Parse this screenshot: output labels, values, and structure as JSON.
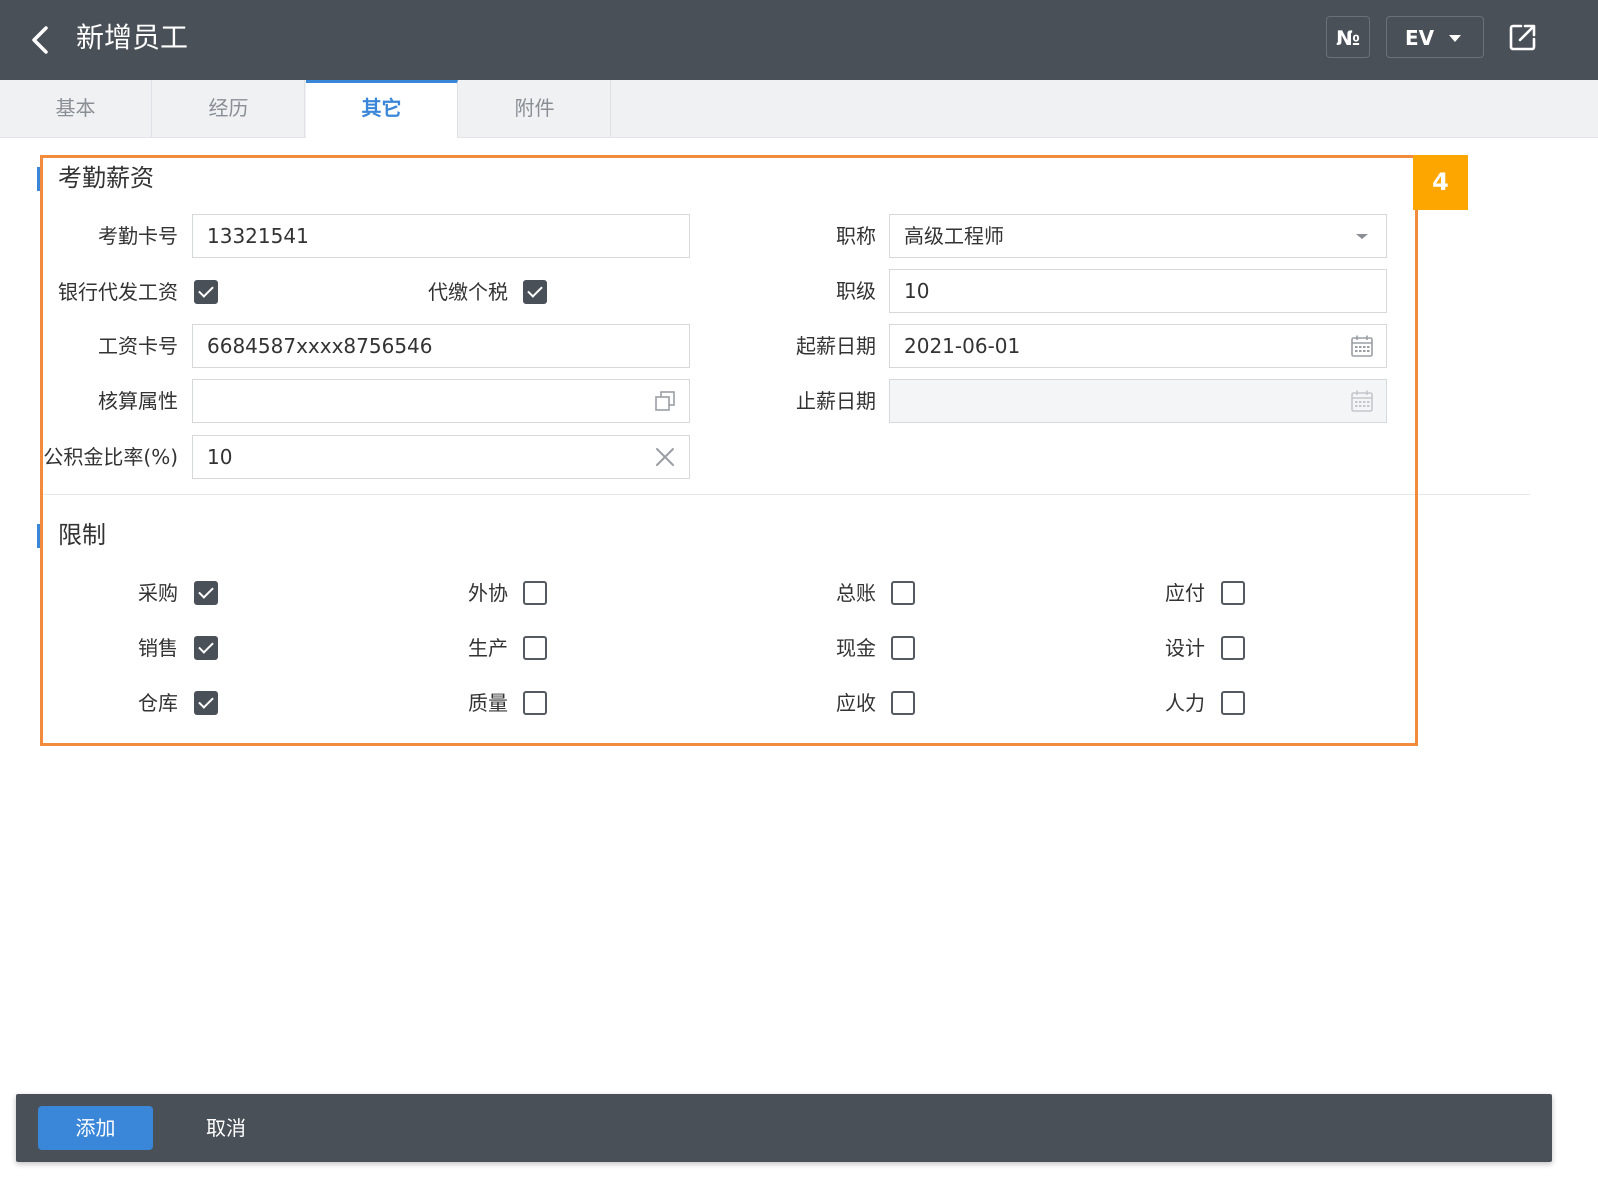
{
  "header": {
    "title": "新增员工",
    "no_label": "№",
    "ev_label": "EV"
  },
  "tabs": [
    {
      "label": "基本",
      "active": false
    },
    {
      "label": "经历",
      "active": false
    },
    {
      "label": "其它",
      "active": true
    },
    {
      "label": "附件",
      "active": false
    }
  ],
  "annotation_badge": "4",
  "attendance": {
    "section_title": "考勤薪资",
    "card_no_label": "考勤卡号",
    "card_no_value": "13321541",
    "bank_payroll_label": "银行代发工资",
    "bank_payroll_checked": true,
    "withhold_tax_label": "代缴个税",
    "withhold_tax_checked": true,
    "salary_card_label": "工资卡号",
    "salary_card_value": "6684587xxxx8756546",
    "accounting_label": "核算属性",
    "accounting_value": "",
    "fund_ratio_label": "公积金比率(%)",
    "fund_ratio_value": "10",
    "title_label": "职称",
    "title_value": "高级工程师",
    "grade_label": "职级",
    "grade_value": "10",
    "start_date_label": "起薪日期",
    "start_date_value": "2021-06-01",
    "stop_date_label": "止薪日期",
    "stop_date_value": ""
  },
  "restrictions": {
    "section_title": "限制",
    "items": [
      {
        "label": "采购",
        "checked": true
      },
      {
        "label": "外协",
        "checked": false
      },
      {
        "label": "总账",
        "checked": false
      },
      {
        "label": "应付",
        "checked": false
      },
      {
        "label": "销售",
        "checked": true
      },
      {
        "label": "生产",
        "checked": false
      },
      {
        "label": "现金",
        "checked": false
      },
      {
        "label": "设计",
        "checked": false
      },
      {
        "label": "仓库",
        "checked": true
      },
      {
        "label": "质量",
        "checked": false
      },
      {
        "label": "应收",
        "checked": false
      },
      {
        "label": "人力",
        "checked": false
      }
    ]
  },
  "footer": {
    "add_label": "添加",
    "cancel_label": "取消"
  }
}
